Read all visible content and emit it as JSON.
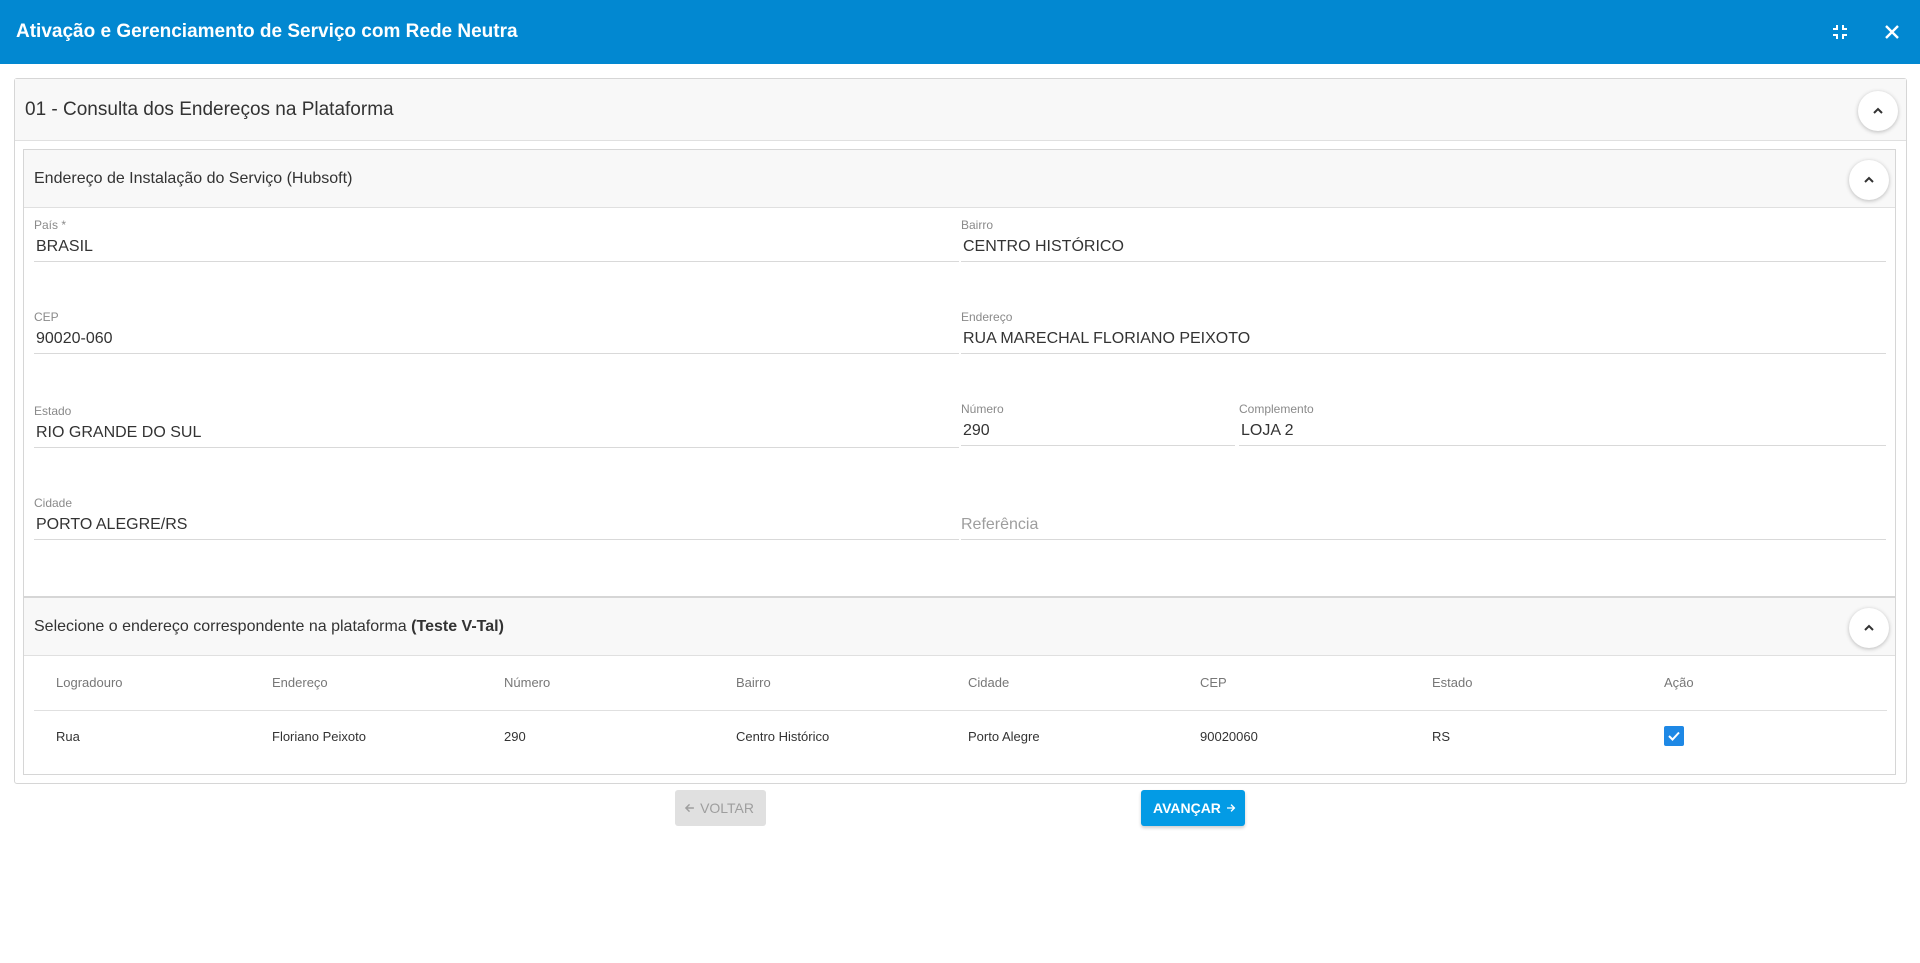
{
  "window": {
    "title": "Ativação e Gerenciamento de Serviço com Rede Neutra",
    "icons": [
      "fullscreen-exit-icon",
      "close-icon"
    ]
  },
  "step": {
    "title": "01 - Consulta dos Endereços na Plataforma"
  },
  "install_address": {
    "title": "Endereço de Instalação do Serviço (Hubsoft)",
    "fields": {
      "pais": {
        "label": "País *",
        "value": "BRASIL"
      },
      "bairro": {
        "label": "Bairro",
        "value": "CENTRO HISTÓRICO"
      },
      "cep": {
        "label": "CEP",
        "value": "90020-060"
      },
      "endereco": {
        "label": "Endereço",
        "value": "RUA MARECHAL FLORIANO PEIXOTO"
      },
      "estado": {
        "label": "Estado",
        "value": "RIO GRANDE DO SUL"
      },
      "numero": {
        "label": "Número",
        "value": "290"
      },
      "complemento": {
        "label": "Complemento",
        "value": "LOJA 2"
      },
      "cidade": {
        "label": "Cidade",
        "value": "PORTO ALEGRE/RS"
      },
      "referencia": {
        "placeholder": "Referência"
      }
    }
  },
  "platform": {
    "title_prefix": "Selecione o endereço correspondente na plataforma",
    "title_bold": "(Teste V-Tal)",
    "columns": [
      "Logradouro",
      "Endereço",
      "Número",
      "Bairro",
      "Cidade",
      "CEP",
      "Estado",
      "Ação"
    ],
    "rows": [
      {
        "logradouro": "Rua",
        "endereco": "Floriano Peixoto",
        "numero": "290",
        "bairro": "Centro Histórico",
        "cidade": "Porto Alegre",
        "cep": "90020060",
        "estado": "RS",
        "selected": true
      }
    ]
  },
  "buttons": {
    "back": "VOLTAR",
    "next": "AVANÇAR"
  },
  "colors": {
    "header": "#0288d1",
    "primary_button": "#039be5",
    "checkbox": "#1e88e5"
  }
}
